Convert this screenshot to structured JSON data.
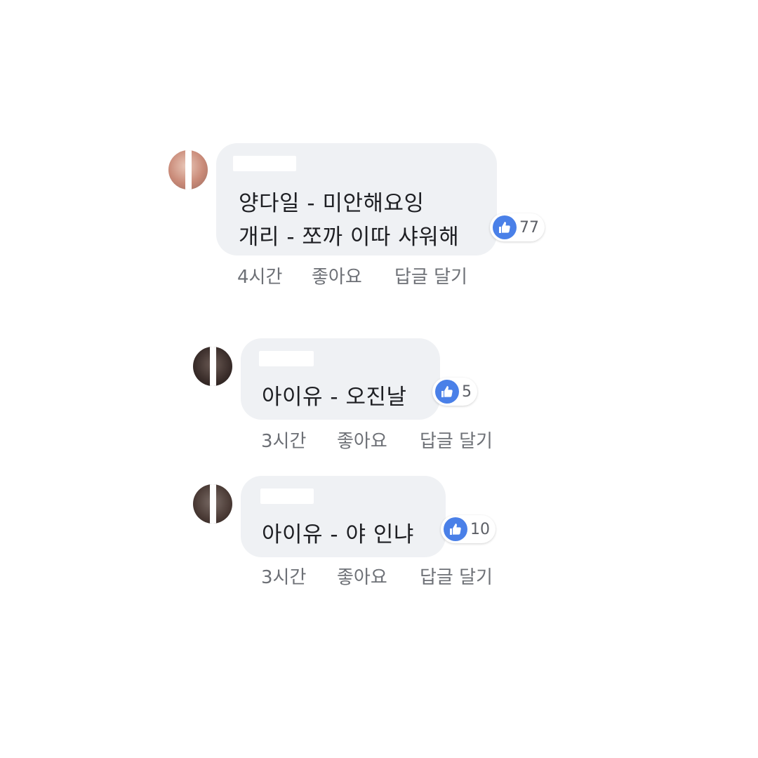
{
  "comments": [
    {
      "lines": [
        "양다일 - 미안해요잉",
        "개리 - 쪼까 이따 샤워해"
      ],
      "likes": "77",
      "time": "4시간",
      "like_label": "좋아요",
      "reply_label": "답글 달기"
    },
    {
      "lines": [
        "아이유 - 오진날"
      ],
      "likes": "5",
      "time": "3시간",
      "like_label": "좋아요",
      "reply_label": "답글 달기"
    },
    {
      "lines": [
        "아이유 - 야 인냐"
      ],
      "likes": "10",
      "time": "3시간",
      "like_label": "좋아요",
      "reply_label": "답글 달기"
    }
  ],
  "colors": {
    "bubble": "#eff1f4",
    "like_blue": "#4a80e8",
    "meta_text": "#6d7076"
  },
  "icons": {
    "reaction": "thumbs-up-icon"
  }
}
